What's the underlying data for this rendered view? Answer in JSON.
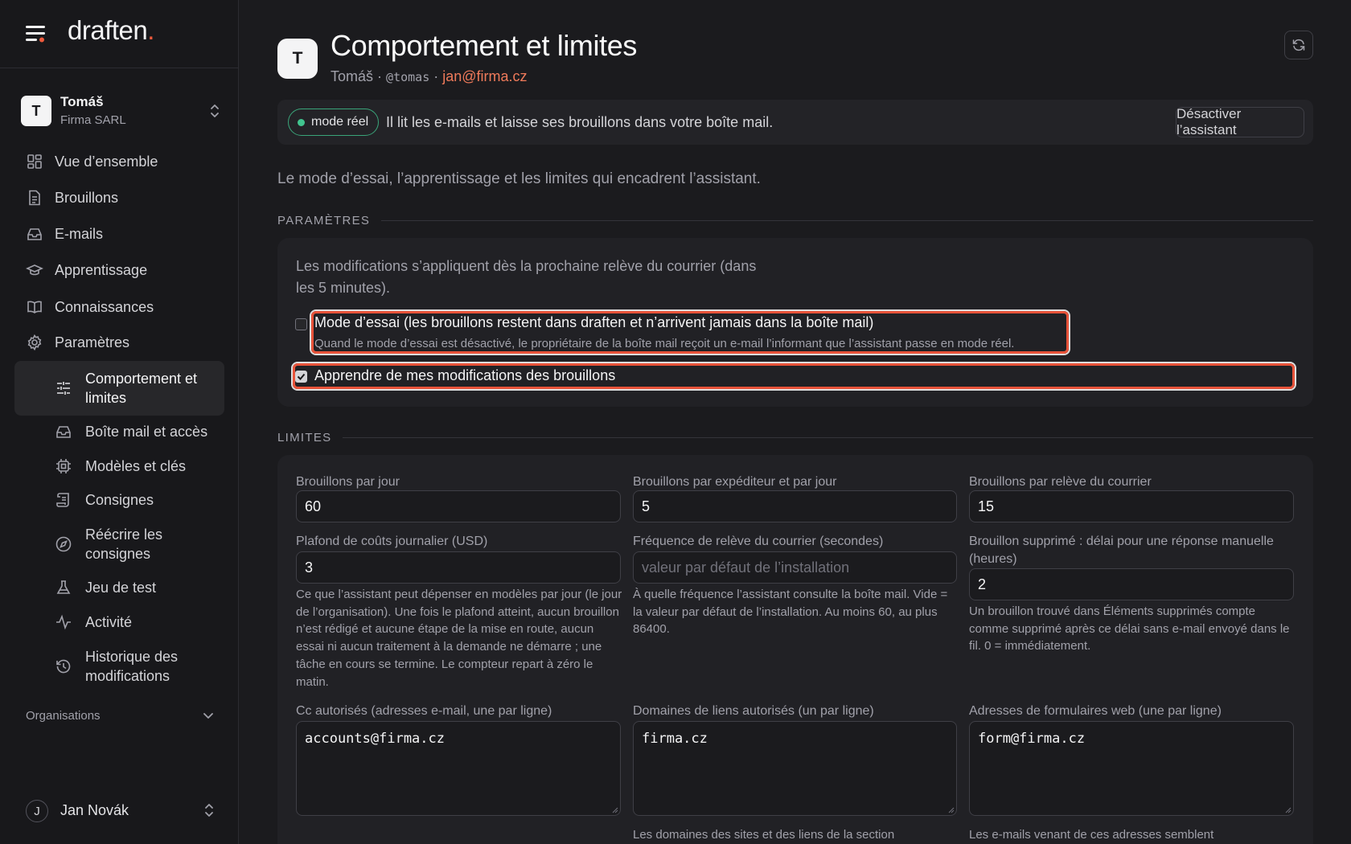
{
  "app": {
    "brand": "draften",
    "brand_dot": "."
  },
  "workspace": {
    "avatar": "T",
    "name": "Tomáš",
    "company": "Firma SARL"
  },
  "nav": [
    {
      "label": "Vue d’ensemble",
      "icon": "grid-icon"
    },
    {
      "label": "Brouillons",
      "icon": "document-icon"
    },
    {
      "label": "E-mails",
      "icon": "inbox-icon"
    },
    {
      "label": "Apprentissage",
      "icon": "graduation-cap-icon"
    },
    {
      "label": "Connaissances",
      "icon": "book-icon"
    },
    {
      "label": "Paramètres",
      "icon": "gear-icon"
    }
  ],
  "settings_nav": [
    {
      "label": "Comportement et limites",
      "icon": "sliders-icon",
      "active": true
    },
    {
      "label": "Boîte mail et accès",
      "icon": "inbox-icon"
    },
    {
      "label": "Modèles et clés",
      "icon": "cpu-icon"
    },
    {
      "label": "Consignes",
      "icon": "script-icon"
    },
    {
      "label": "Réécrire les consignes",
      "icon": "compass-icon"
    },
    {
      "label": "Jeu de test",
      "icon": "flask-icon"
    },
    {
      "label": "Activité",
      "icon": "activity-icon"
    },
    {
      "label": "Historique des modifications",
      "icon": "history-icon"
    }
  ],
  "organisations_label": "Organisations",
  "user": {
    "initial": "J",
    "name": "Jan Novák"
  },
  "page": {
    "avatar": "T",
    "title": "Comportement et limites",
    "owner": "Tomáš",
    "sep": "·",
    "handle": "@tomas",
    "email": "jan@firma.cz"
  },
  "status": {
    "badge": "mode réel",
    "text": "Il lit les e-mails et laisse ses brouillons dans votre boîte mail.",
    "button": "Désactiver l’assistant"
  },
  "intro": "Le mode d’essai, l’apprentissage et les limites qui encadrent l’assistant.",
  "params": {
    "heading": "PARAMÈTRES",
    "note": "Les modifications s’appliquent dès la prochaine relève du courrier (dans les 5 minutes).",
    "trial_mode": {
      "label": "Mode d’essai (les brouillons restent dans draften et n’arrivent jamais dans la boîte mail)",
      "help": "Quand le mode d’essai est désactivé, le propriétaire de la boîte mail reçoit un e-mail l’informant que l’assistant passe en mode réel.",
      "checked": false
    },
    "learn": {
      "label": "Apprendre de mes modifications des brouillons",
      "checked": true
    }
  },
  "limits": {
    "heading": "LIMITES",
    "drafts_per_day": {
      "label": "Brouillons par jour",
      "value": "60"
    },
    "drafts_per_sender": {
      "label": "Brouillons par expéditeur et par jour",
      "value": "5"
    },
    "drafts_per_poll": {
      "label": "Brouillons par relève du courrier",
      "value": "15"
    },
    "cost_cap": {
      "label": "Plafond de coûts journalier (USD)",
      "value": "3",
      "help": "Ce que l’assistant peut dépenser en modèles par jour (le jour de l’organisation). Une fois le plafond atteint, aucun brouillon n’est rédigé et aucune étape de la mise en route, aucun essai ni aucun traitement à la demande ne démarre ; une tâche en cours se termine. Le compteur repart à zéro le matin."
    },
    "poll_frequency": {
      "label": "Fréquence de relève du courrier (secondes)",
      "placeholder": "valeur par défaut de l’installation",
      "help": "À quelle fréquence l’assistant consulte la boîte mail. Vide = la valeur par défaut de l’installation. Au moins 60, au plus 86400."
    },
    "deleted_delay": {
      "label": "Brouillon supprimé : délai pour une réponse manuelle (heures)",
      "value": "2",
      "help": "Un brouillon trouvé dans Éléments supprimés compte comme supprimé après ce délai sans e-mail envoyé dans le fil. 0 = immédiatement."
    },
    "allowed_cc": {
      "label": "Cc autorisés (adresses e-mail, une par ligne)",
      "value": "accounts@firma.cz"
    },
    "allowed_domains": {
      "label": "Domaines de liens autorisés (un par ligne)",
      "value": "firma.cz",
      "help": "Les domaines des sites et des liens de la section"
    },
    "web_forms": {
      "label": "Adresses de formulaires web (une par ligne)",
      "value": "form@firma.cz",
      "help": "Les e-mails venant de ces adresses semblent"
    }
  }
}
